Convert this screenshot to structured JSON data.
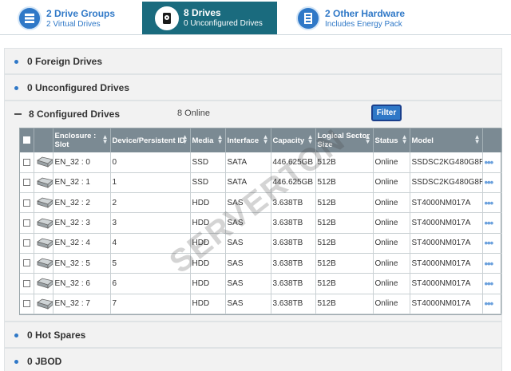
{
  "tabs": [
    {
      "title": "2 Drive Groups",
      "subtitle": "2 Virtual Drives",
      "icon": "drive-groups-icon"
    },
    {
      "title": "8 Drives",
      "subtitle": "0 Unconfigured Drives",
      "icon": "hard-drive-icon"
    },
    {
      "title": "2 Other Hardware",
      "subtitle": "Includes Energy Pack",
      "icon": "hardware-icon"
    }
  ],
  "sections": {
    "foreign": "0 Foreign Drives",
    "unconfigured": "0 Unconfigured Drives",
    "configured": "8 Configured Drives",
    "configured_online": "8 Online",
    "filter_label": "Filter",
    "hot_spares": "0 Hot Spares",
    "jbod": "0 JBOD"
  },
  "table": {
    "headers": [
      "Enclosure : Slot",
      "Device/Persistent ID",
      "Media",
      "Interface",
      "Capacity",
      "Logical Sector Size",
      "Status",
      "Model"
    ],
    "rows": [
      {
        "slot": "EN_32 : 0",
        "id": "0",
        "media": "SSD",
        "iface": "SATA",
        "cap": "446.625GB",
        "lss": "512B",
        "status": "Online",
        "model": "SSDSC2KG480G8R"
      },
      {
        "slot": "EN_32 : 1",
        "id": "1",
        "media": "SSD",
        "iface": "SATA",
        "cap": "446.625GB",
        "lss": "512B",
        "status": "Online",
        "model": "SSDSC2KG480G8R"
      },
      {
        "slot": "EN_32 : 2",
        "id": "2",
        "media": "HDD",
        "iface": "SAS",
        "cap": "3.638TB",
        "lss": "512B",
        "status": "Online",
        "model": "ST4000NM017A"
      },
      {
        "slot": "EN_32 : 3",
        "id": "3",
        "media": "HDD",
        "iface": "SAS",
        "cap": "3.638TB",
        "lss": "512B",
        "status": "Online",
        "model": "ST4000NM017A"
      },
      {
        "slot": "EN_32 : 4",
        "id": "4",
        "media": "HDD",
        "iface": "SAS",
        "cap": "3.638TB",
        "lss": "512B",
        "status": "Online",
        "model": "ST4000NM017A"
      },
      {
        "slot": "EN_32 : 5",
        "id": "5",
        "media": "HDD",
        "iface": "SAS",
        "cap": "3.638TB",
        "lss": "512B",
        "status": "Online",
        "model": "ST4000NM017A"
      },
      {
        "slot": "EN_32 : 6",
        "id": "6",
        "media": "HDD",
        "iface": "SAS",
        "cap": "3.638TB",
        "lss": "512B",
        "status": "Online",
        "model": "ST4000NM017A"
      },
      {
        "slot": "EN_32 : 7",
        "id": "7",
        "media": "HDD",
        "iface": "SAS",
        "cap": "3.638TB",
        "lss": "512B",
        "status": "Online",
        "model": "ST4000NM017A"
      }
    ],
    "more_glyph": "•••"
  },
  "watermark": "SERVERTON",
  "colors": {
    "accent": "#2f78c7",
    "active_tab": "#1a6b7e",
    "header": "#7b8a93"
  }
}
